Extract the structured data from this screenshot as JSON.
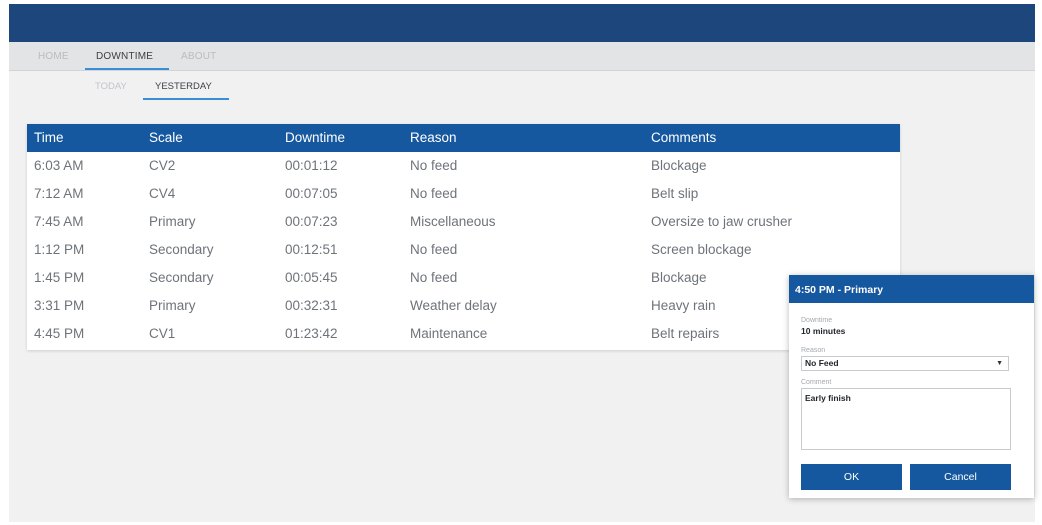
{
  "nav": {
    "tabs": [
      {
        "label": "HOME",
        "active": false
      },
      {
        "label": "DOWNTIME",
        "active": true
      },
      {
        "label": "ABOUT",
        "active": false
      }
    ]
  },
  "subnav": {
    "tabs": [
      {
        "label": "TODAY",
        "active": false
      },
      {
        "label": "YESTERDAY",
        "active": true
      }
    ]
  },
  "table": {
    "columns": [
      "Time",
      "Scale",
      "Downtime",
      "Reason",
      "Comments"
    ],
    "rows": [
      [
        "6:03 AM",
        "CV2",
        "00:01:12",
        "No feed",
        "Blockage"
      ],
      [
        "7:12 AM",
        "CV4",
        "00:07:05",
        "No feed",
        "Belt slip"
      ],
      [
        "7:45 AM",
        "Primary",
        "00:07:23",
        "Miscellaneous",
        "Oversize to jaw crusher"
      ],
      [
        "1:12 PM",
        "Secondary",
        "00:12:51",
        "No feed",
        "Screen blockage"
      ],
      [
        "1:45 PM",
        "Secondary",
        "00:05:45",
        "No feed",
        "Blockage"
      ],
      [
        "3:31 PM",
        "Primary",
        "00:32:31",
        "Weather delay",
        "Heavy rain"
      ],
      [
        "4:45 PM",
        "CV1",
        "01:23:42",
        "Maintenance",
        "Belt repairs"
      ]
    ]
  },
  "dialog": {
    "title": "4:50 PM - Primary",
    "downtime_label": "Downtime",
    "downtime_value": "10 minutes",
    "reason_label": "Reason",
    "reason_value": "No Feed",
    "comment_label": "Comment",
    "comment_value": "Early finish",
    "ok_label": "OK",
    "cancel_label": "Cancel"
  },
  "colors": {
    "title_bar": "#1d467d",
    "accent_blue": "#16589f",
    "tab_underline": "#3a8ed8"
  }
}
